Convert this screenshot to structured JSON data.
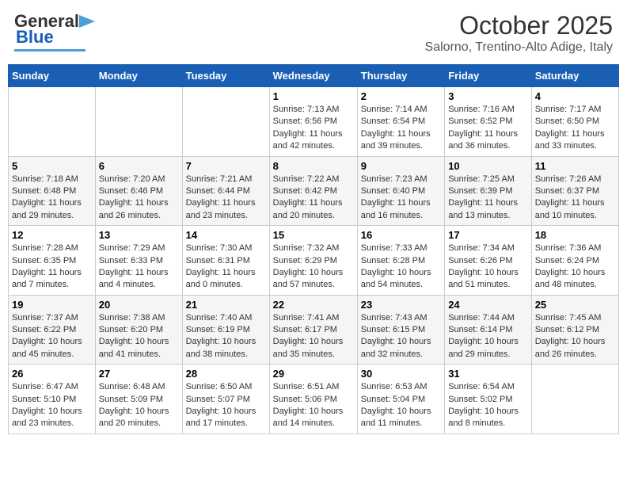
{
  "logo": {
    "general": "General",
    "blue": "Blue"
  },
  "title": "October 2025",
  "subtitle": "Salorno, Trentino-Alto Adige, Italy",
  "days_of_week": [
    "Sunday",
    "Monday",
    "Tuesday",
    "Wednesday",
    "Thursday",
    "Friday",
    "Saturday"
  ],
  "weeks": [
    [
      {
        "day": "",
        "info": ""
      },
      {
        "day": "",
        "info": ""
      },
      {
        "day": "",
        "info": ""
      },
      {
        "day": "1",
        "info": "Sunrise: 7:13 AM\nSunset: 6:56 PM\nDaylight: 11 hours and 42 minutes."
      },
      {
        "day": "2",
        "info": "Sunrise: 7:14 AM\nSunset: 6:54 PM\nDaylight: 11 hours and 39 minutes."
      },
      {
        "day": "3",
        "info": "Sunrise: 7:16 AM\nSunset: 6:52 PM\nDaylight: 11 hours and 36 minutes."
      },
      {
        "day": "4",
        "info": "Sunrise: 7:17 AM\nSunset: 6:50 PM\nDaylight: 11 hours and 33 minutes."
      }
    ],
    [
      {
        "day": "5",
        "info": "Sunrise: 7:18 AM\nSunset: 6:48 PM\nDaylight: 11 hours and 29 minutes."
      },
      {
        "day": "6",
        "info": "Sunrise: 7:20 AM\nSunset: 6:46 PM\nDaylight: 11 hours and 26 minutes."
      },
      {
        "day": "7",
        "info": "Sunrise: 7:21 AM\nSunset: 6:44 PM\nDaylight: 11 hours and 23 minutes."
      },
      {
        "day": "8",
        "info": "Sunrise: 7:22 AM\nSunset: 6:42 PM\nDaylight: 11 hours and 20 minutes."
      },
      {
        "day": "9",
        "info": "Sunrise: 7:23 AM\nSunset: 6:40 PM\nDaylight: 11 hours and 16 minutes."
      },
      {
        "day": "10",
        "info": "Sunrise: 7:25 AM\nSunset: 6:39 PM\nDaylight: 11 hours and 13 minutes."
      },
      {
        "day": "11",
        "info": "Sunrise: 7:26 AM\nSunset: 6:37 PM\nDaylight: 11 hours and 10 minutes."
      }
    ],
    [
      {
        "day": "12",
        "info": "Sunrise: 7:28 AM\nSunset: 6:35 PM\nDaylight: 11 hours and 7 minutes."
      },
      {
        "day": "13",
        "info": "Sunrise: 7:29 AM\nSunset: 6:33 PM\nDaylight: 11 hours and 4 minutes."
      },
      {
        "day": "14",
        "info": "Sunrise: 7:30 AM\nSunset: 6:31 PM\nDaylight: 11 hours and 0 minutes."
      },
      {
        "day": "15",
        "info": "Sunrise: 7:32 AM\nSunset: 6:29 PM\nDaylight: 10 hours and 57 minutes."
      },
      {
        "day": "16",
        "info": "Sunrise: 7:33 AM\nSunset: 6:28 PM\nDaylight: 10 hours and 54 minutes."
      },
      {
        "day": "17",
        "info": "Sunrise: 7:34 AM\nSunset: 6:26 PM\nDaylight: 10 hours and 51 minutes."
      },
      {
        "day": "18",
        "info": "Sunrise: 7:36 AM\nSunset: 6:24 PM\nDaylight: 10 hours and 48 minutes."
      }
    ],
    [
      {
        "day": "19",
        "info": "Sunrise: 7:37 AM\nSunset: 6:22 PM\nDaylight: 10 hours and 45 minutes."
      },
      {
        "day": "20",
        "info": "Sunrise: 7:38 AM\nSunset: 6:20 PM\nDaylight: 10 hours and 41 minutes."
      },
      {
        "day": "21",
        "info": "Sunrise: 7:40 AM\nSunset: 6:19 PM\nDaylight: 10 hours and 38 minutes."
      },
      {
        "day": "22",
        "info": "Sunrise: 7:41 AM\nSunset: 6:17 PM\nDaylight: 10 hours and 35 minutes."
      },
      {
        "day": "23",
        "info": "Sunrise: 7:43 AM\nSunset: 6:15 PM\nDaylight: 10 hours and 32 minutes."
      },
      {
        "day": "24",
        "info": "Sunrise: 7:44 AM\nSunset: 6:14 PM\nDaylight: 10 hours and 29 minutes."
      },
      {
        "day": "25",
        "info": "Sunrise: 7:45 AM\nSunset: 6:12 PM\nDaylight: 10 hours and 26 minutes."
      }
    ],
    [
      {
        "day": "26",
        "info": "Sunrise: 6:47 AM\nSunset: 5:10 PM\nDaylight: 10 hours and 23 minutes."
      },
      {
        "day": "27",
        "info": "Sunrise: 6:48 AM\nSunset: 5:09 PM\nDaylight: 10 hours and 20 minutes."
      },
      {
        "day": "28",
        "info": "Sunrise: 6:50 AM\nSunset: 5:07 PM\nDaylight: 10 hours and 17 minutes."
      },
      {
        "day": "29",
        "info": "Sunrise: 6:51 AM\nSunset: 5:06 PM\nDaylight: 10 hours and 14 minutes."
      },
      {
        "day": "30",
        "info": "Sunrise: 6:53 AM\nSunset: 5:04 PM\nDaylight: 10 hours and 11 minutes."
      },
      {
        "day": "31",
        "info": "Sunrise: 6:54 AM\nSunset: 5:02 PM\nDaylight: 10 hours and 8 minutes."
      },
      {
        "day": "",
        "info": ""
      }
    ]
  ]
}
